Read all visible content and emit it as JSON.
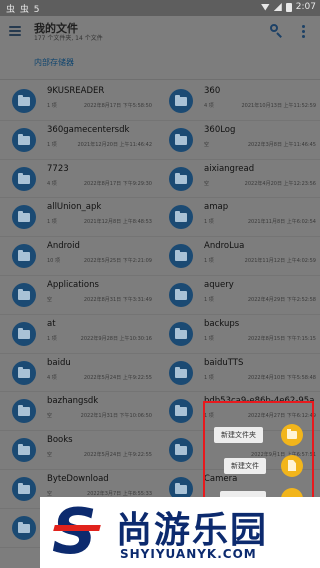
{
  "status_bar": {
    "left_glyphs": "虫 虫 5",
    "time": "2:07"
  },
  "app_bar": {
    "title": "我的文件",
    "subtitle": "177 个文件夹, 14 个文件"
  },
  "breadcrumb": {
    "label": "内部存储器"
  },
  "folders": [
    {
      "name": "9KUSREADER",
      "count": "1 项",
      "date": "2022年8月17日 下午5:58:50"
    },
    {
      "name": "360",
      "count": "4 项",
      "date": "2021年10月13日 上午11:52:59"
    },
    {
      "name": "360gamecentersdk",
      "count": "1 项",
      "date": "2021年12月20日 上午11:46:42"
    },
    {
      "name": "360Log",
      "count": "空",
      "date": "2022年3月8日 上午11:46:45"
    },
    {
      "name": "7723",
      "count": "4 项",
      "date": "2022年8月17日 下午9:29:30"
    },
    {
      "name": "aixiangread",
      "count": "空",
      "date": "2022年4月20日 上午12:23:56"
    },
    {
      "name": "allUnion_apk",
      "count": "1 项",
      "date": "2021年12月8日 上午8:48:53"
    },
    {
      "name": "amap",
      "count": "1 项",
      "date": "2021年11月8日 上午6:02:54"
    },
    {
      "name": "Android",
      "count": "10 项",
      "date": "2022年5月25日 下午2:21:09"
    },
    {
      "name": "AndroLua",
      "count": "1 项",
      "date": "2021年11月12日 上午4:02:59"
    },
    {
      "name": "Applications",
      "count": "空",
      "date": "2022年8月31日 下午3:31:49"
    },
    {
      "name": "aquery",
      "count": "1 项",
      "date": "2022年4月29日 下午2:52:58"
    },
    {
      "name": "at",
      "count": "1 项",
      "date": "2022年9月28日 上午10:30:16"
    },
    {
      "name": "backups",
      "count": "1 项",
      "date": "2022年8月15日 下午7:15:15"
    },
    {
      "name": "baidu",
      "count": "4 项",
      "date": "2022年5月24日 上午9:22:55"
    },
    {
      "name": "baiduTTS",
      "count": "1 项",
      "date": "2022年4月10日 下午5:58:48"
    },
    {
      "name": "bazhangsdk",
      "count": "空",
      "date": "2022年1月31日 下午10:06:50"
    },
    {
      "name": "bdb53ca9-e86b-4e62-95a",
      "count": "1 项",
      "date": "2022年4月27日 下午6:12:49"
    },
    {
      "name": "Books",
      "count": "空",
      "date": "2022年5月24日 上午9:22:55"
    },
    {
      "name": "",
      "count": "",
      "date": "2022年9月1日 上午6:57:51"
    },
    {
      "name": "ByteDownload",
      "count": "空",
      "date": "2022年3月7日 上午8:55:33"
    },
    {
      "name": "Camera",
      "count": "",
      "date": ""
    },
    {
      "name": "",
      "count": "",
      "date": ""
    },
    {
      "name": "",
      "count": "",
      "date": ""
    }
  ],
  "fab_menu": {
    "new_folder": "新建文件夹",
    "new_file": "新建文件"
  },
  "watermark": {
    "brand": "尚游乐园",
    "url": "SHYIYUANYK.COM",
    "logo_letter": "S"
  },
  "colors": {
    "folder_circle": "#1b4a73",
    "fab": "#f2b51b",
    "highlight_box": "#e8191d"
  }
}
